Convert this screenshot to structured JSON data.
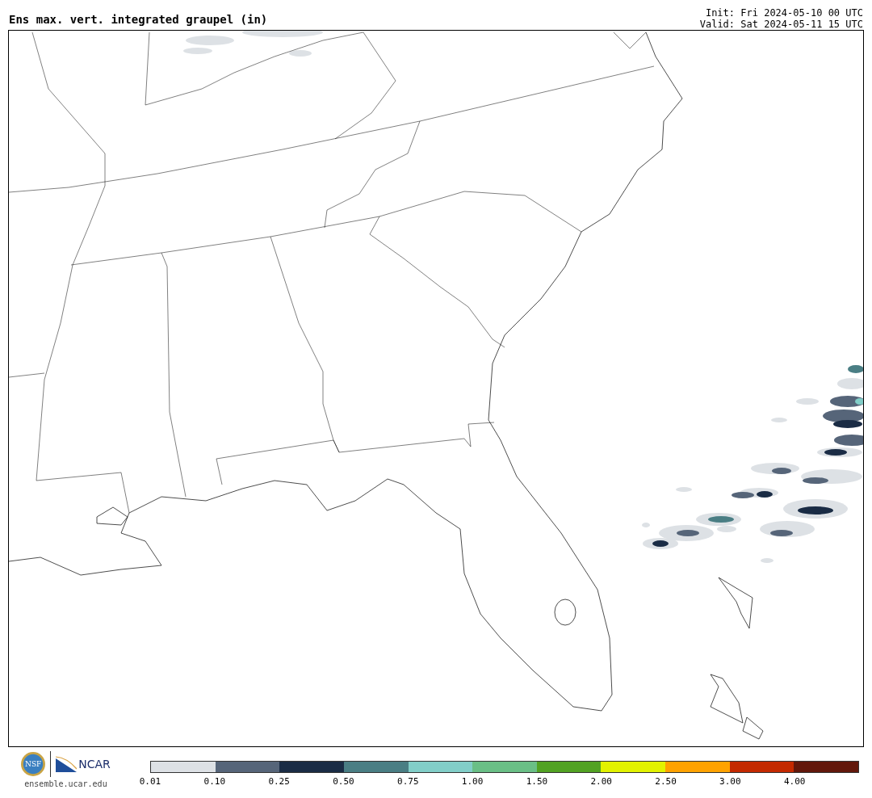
{
  "header": {
    "title": "Ens max. vert. integrated graupel (in)",
    "init": "Init: Fri 2024-05-10 00 UTC",
    "valid": "Valid: Sat 2024-05-11 15 UTC"
  },
  "footer": {
    "nsf_logo_text": "NSF",
    "ncar_logo_text": "NCAR",
    "url": "ensemble.ucar.edu"
  },
  "colorbar": {
    "bins": [
      {
        "color": "#dde1e5"
      },
      {
        "color": "#566579"
      },
      {
        "color": "#1a2c45"
      },
      {
        "color": "#4a7e84"
      },
      {
        "color": "#82cec8"
      },
      {
        "color": "#6abf86"
      },
      {
        "color": "#52a223"
      },
      {
        "color": "#e2f200"
      },
      {
        "color": "#ffa200"
      },
      {
        "color": "#c42a00"
      },
      {
        "color": "#62180b"
      }
    ],
    "ticks": [
      "0.01",
      "0.10",
      "0.25",
      "0.50",
      "0.75",
      "1.00",
      "1.50",
      "2.00",
      "2.50",
      "3.00",
      "4.00"
    ]
  }
}
